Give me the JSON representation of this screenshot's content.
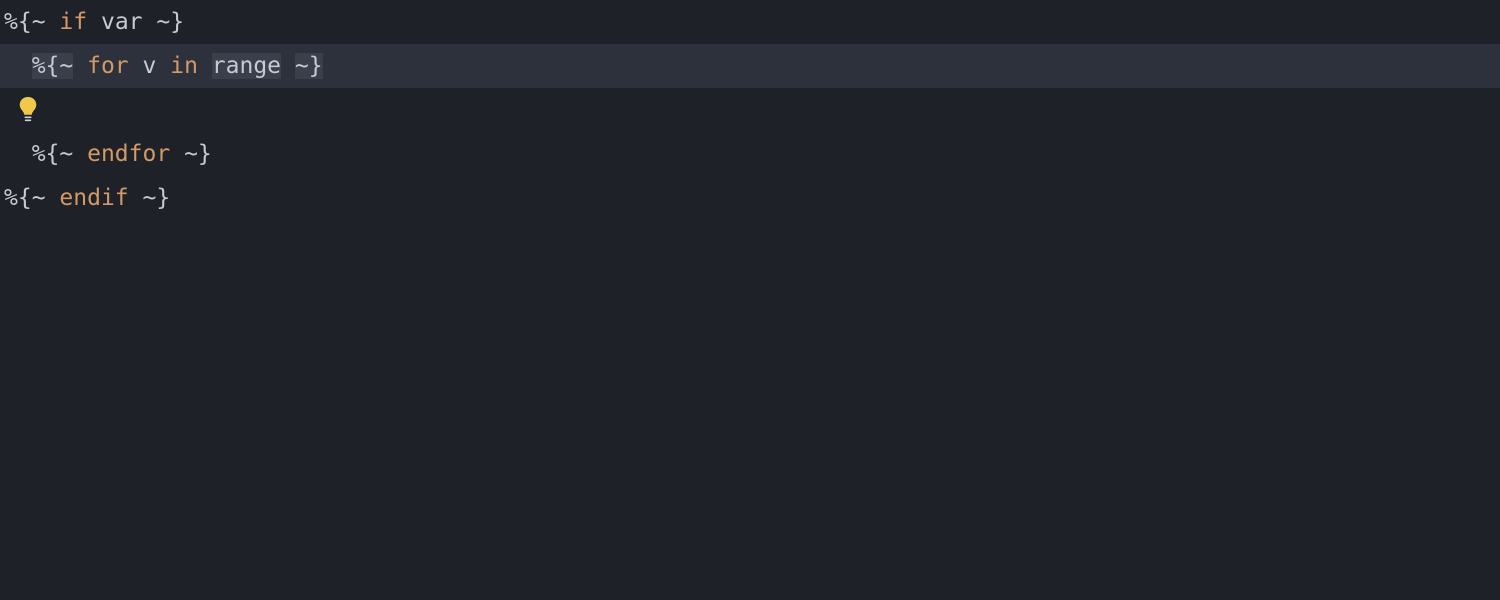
{
  "editor": {
    "lines": {
      "l1": {
        "open_delim": "%{~",
        "keyword": "if",
        "var": "var",
        "close_delim": "~}"
      },
      "l2": {
        "indent": "  ",
        "open_delim": "%{~",
        "keyword": "for",
        "loopvar": "v",
        "in": "in",
        "range": "range",
        "close_delim": "~}"
      },
      "l4": {
        "indent": "  ",
        "open_delim": "%{~",
        "keyword": "endfor",
        "close_delim": "~}"
      },
      "l5": {
        "open_delim": "%{~",
        "keyword": "endif",
        "close_delim": "~}"
      }
    },
    "icons": {
      "bulb": "lightbulb"
    },
    "colors": {
      "background": "#1e2127",
      "line_highlight": "#2c313c",
      "delimiter_highlight": "#3a3f4b",
      "keyword": "#d19a66",
      "text": "#c5cad3",
      "bulb": "#f0c84a"
    }
  }
}
